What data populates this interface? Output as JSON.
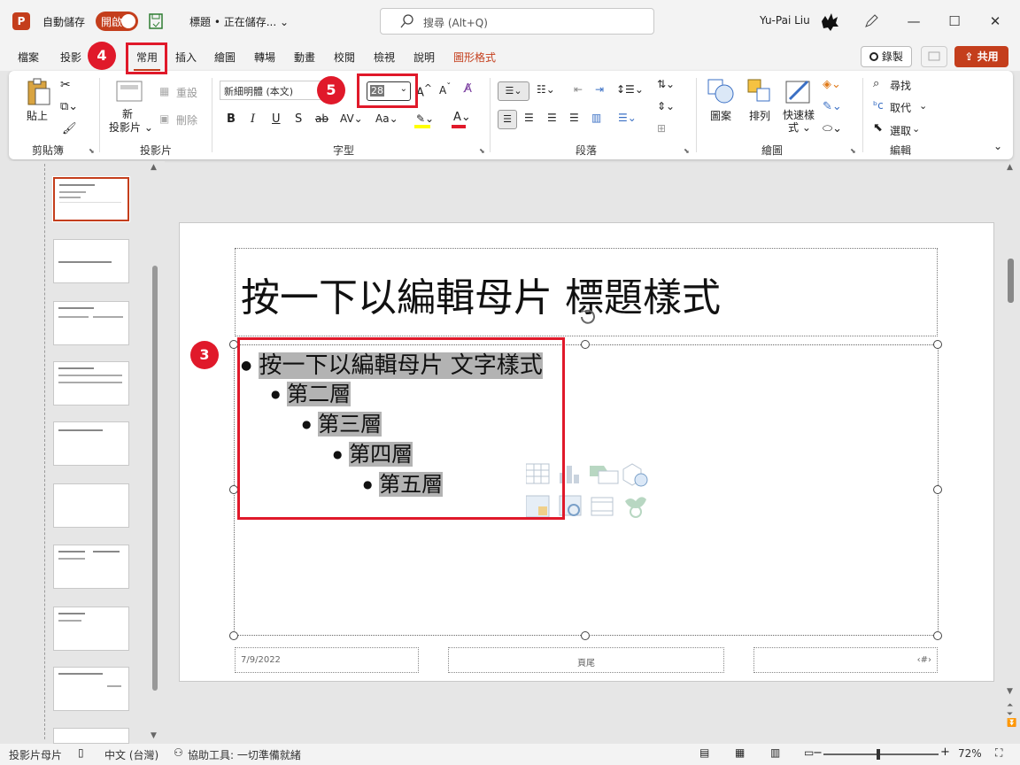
{
  "titlebar": {
    "autosave_label": "自動儲存",
    "autosave_state": "開啟",
    "doc_title": "標題 • 正在儲存... ⌄",
    "search_placeholder": "搜尋 (Alt+Q)",
    "user_name": "Yu-Pai Liu"
  },
  "tabs": [
    "檔案",
    "投影",
    "常用",
    "插入",
    "繪圖",
    "轉場",
    "動畫",
    "校閱",
    "檢視",
    "說明",
    "圖形格式"
  ],
  "active_tab": "常用",
  "tab_actions": {
    "record": "錄製",
    "share": "共用"
  },
  "ribbon": {
    "clipboard": {
      "paste": "貼上",
      "label": "剪貼簿"
    },
    "slides": {
      "new_slide": "新",
      "new_slide2": "投影片 ⌄",
      "reset": "重設",
      "delete": "刪除",
      "label": "投影片"
    },
    "font": {
      "font_name": "新細明體 (本文)",
      "font_size": "28",
      "label": "字型"
    },
    "paragraph": {
      "label": "段落"
    },
    "drawing": {
      "shapes": "圖案",
      "arrange": "排列",
      "quick_styles": "快速樣",
      "quick_styles2": "式 ⌄",
      "label": "繪圖"
    },
    "editing": {
      "find": "尋找",
      "replace": "取代",
      "select": "選取",
      "label": "編輯"
    }
  },
  "slide": {
    "title": "按一下以編輯母片 標題樣式",
    "bullets": [
      "按一下以編輯母片 文字樣式",
      "第二層",
      "第三層",
      "第四層",
      "第五層"
    ],
    "footer_date": "7/9/2022",
    "footer_text": "頁尾",
    "footer_page": "‹#›"
  },
  "annotations": {
    "badge3": "3",
    "badge4": "4",
    "badge5": "5"
  },
  "statusbar": {
    "view": "投影片母片",
    "language": "中文 (台灣)",
    "accessibility": "協助工具: 一切準備就緒",
    "zoom": "72%"
  },
  "colors": {
    "accent": "#c43e1c",
    "annotation_red": "#e0192a"
  }
}
